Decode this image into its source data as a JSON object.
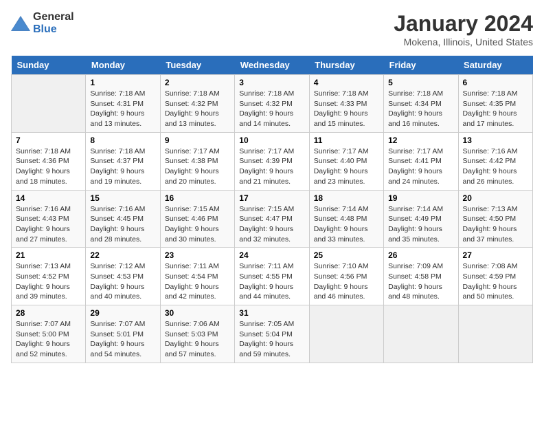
{
  "header": {
    "logo_general": "General",
    "logo_blue": "Blue",
    "title": "January 2024",
    "subtitle": "Mokena, Illinois, United States"
  },
  "days_of_week": [
    "Sunday",
    "Monday",
    "Tuesday",
    "Wednesday",
    "Thursday",
    "Friday",
    "Saturday"
  ],
  "weeks": [
    [
      {
        "day": "",
        "empty": true
      },
      {
        "day": "1",
        "sunrise": "Sunrise: 7:18 AM",
        "sunset": "Sunset: 4:31 PM",
        "daylight": "Daylight: 9 hours and 13 minutes."
      },
      {
        "day": "2",
        "sunrise": "Sunrise: 7:18 AM",
        "sunset": "Sunset: 4:32 PM",
        "daylight": "Daylight: 9 hours and 13 minutes."
      },
      {
        "day": "3",
        "sunrise": "Sunrise: 7:18 AM",
        "sunset": "Sunset: 4:32 PM",
        "daylight": "Daylight: 9 hours and 14 minutes."
      },
      {
        "day": "4",
        "sunrise": "Sunrise: 7:18 AM",
        "sunset": "Sunset: 4:33 PM",
        "daylight": "Daylight: 9 hours and 15 minutes."
      },
      {
        "day": "5",
        "sunrise": "Sunrise: 7:18 AM",
        "sunset": "Sunset: 4:34 PM",
        "daylight": "Daylight: 9 hours and 16 minutes."
      },
      {
        "day": "6",
        "sunrise": "Sunrise: 7:18 AM",
        "sunset": "Sunset: 4:35 PM",
        "daylight": "Daylight: 9 hours and 17 minutes."
      }
    ],
    [
      {
        "day": "7",
        "sunrise": "Sunrise: 7:18 AM",
        "sunset": "Sunset: 4:36 PM",
        "daylight": "Daylight: 9 hours and 18 minutes."
      },
      {
        "day": "8",
        "sunrise": "Sunrise: 7:18 AM",
        "sunset": "Sunset: 4:37 PM",
        "daylight": "Daylight: 9 hours and 19 minutes."
      },
      {
        "day": "9",
        "sunrise": "Sunrise: 7:17 AM",
        "sunset": "Sunset: 4:38 PM",
        "daylight": "Daylight: 9 hours and 20 minutes."
      },
      {
        "day": "10",
        "sunrise": "Sunrise: 7:17 AM",
        "sunset": "Sunset: 4:39 PM",
        "daylight": "Daylight: 9 hours and 21 minutes."
      },
      {
        "day": "11",
        "sunrise": "Sunrise: 7:17 AM",
        "sunset": "Sunset: 4:40 PM",
        "daylight": "Daylight: 9 hours and 23 minutes."
      },
      {
        "day": "12",
        "sunrise": "Sunrise: 7:17 AM",
        "sunset": "Sunset: 4:41 PM",
        "daylight": "Daylight: 9 hours and 24 minutes."
      },
      {
        "day": "13",
        "sunrise": "Sunrise: 7:16 AM",
        "sunset": "Sunset: 4:42 PM",
        "daylight": "Daylight: 9 hours and 26 minutes."
      }
    ],
    [
      {
        "day": "14",
        "sunrise": "Sunrise: 7:16 AM",
        "sunset": "Sunset: 4:43 PM",
        "daylight": "Daylight: 9 hours and 27 minutes."
      },
      {
        "day": "15",
        "sunrise": "Sunrise: 7:16 AM",
        "sunset": "Sunset: 4:45 PM",
        "daylight": "Daylight: 9 hours and 28 minutes."
      },
      {
        "day": "16",
        "sunrise": "Sunrise: 7:15 AM",
        "sunset": "Sunset: 4:46 PM",
        "daylight": "Daylight: 9 hours and 30 minutes."
      },
      {
        "day": "17",
        "sunrise": "Sunrise: 7:15 AM",
        "sunset": "Sunset: 4:47 PM",
        "daylight": "Daylight: 9 hours and 32 minutes."
      },
      {
        "day": "18",
        "sunrise": "Sunrise: 7:14 AM",
        "sunset": "Sunset: 4:48 PM",
        "daylight": "Daylight: 9 hours and 33 minutes."
      },
      {
        "day": "19",
        "sunrise": "Sunrise: 7:14 AM",
        "sunset": "Sunset: 4:49 PM",
        "daylight": "Daylight: 9 hours and 35 minutes."
      },
      {
        "day": "20",
        "sunrise": "Sunrise: 7:13 AM",
        "sunset": "Sunset: 4:50 PM",
        "daylight": "Daylight: 9 hours and 37 minutes."
      }
    ],
    [
      {
        "day": "21",
        "sunrise": "Sunrise: 7:13 AM",
        "sunset": "Sunset: 4:52 PM",
        "daylight": "Daylight: 9 hours and 39 minutes."
      },
      {
        "day": "22",
        "sunrise": "Sunrise: 7:12 AM",
        "sunset": "Sunset: 4:53 PM",
        "daylight": "Daylight: 9 hours and 40 minutes."
      },
      {
        "day": "23",
        "sunrise": "Sunrise: 7:11 AM",
        "sunset": "Sunset: 4:54 PM",
        "daylight": "Daylight: 9 hours and 42 minutes."
      },
      {
        "day": "24",
        "sunrise": "Sunrise: 7:11 AM",
        "sunset": "Sunset: 4:55 PM",
        "daylight": "Daylight: 9 hours and 44 minutes."
      },
      {
        "day": "25",
        "sunrise": "Sunrise: 7:10 AM",
        "sunset": "Sunset: 4:56 PM",
        "daylight": "Daylight: 9 hours and 46 minutes."
      },
      {
        "day": "26",
        "sunrise": "Sunrise: 7:09 AM",
        "sunset": "Sunset: 4:58 PM",
        "daylight": "Daylight: 9 hours and 48 minutes."
      },
      {
        "day": "27",
        "sunrise": "Sunrise: 7:08 AM",
        "sunset": "Sunset: 4:59 PM",
        "daylight": "Daylight: 9 hours and 50 minutes."
      }
    ],
    [
      {
        "day": "28",
        "sunrise": "Sunrise: 7:07 AM",
        "sunset": "Sunset: 5:00 PM",
        "daylight": "Daylight: 9 hours and 52 minutes."
      },
      {
        "day": "29",
        "sunrise": "Sunrise: 7:07 AM",
        "sunset": "Sunset: 5:01 PM",
        "daylight": "Daylight: 9 hours and 54 minutes."
      },
      {
        "day": "30",
        "sunrise": "Sunrise: 7:06 AM",
        "sunset": "Sunset: 5:03 PM",
        "daylight": "Daylight: 9 hours and 57 minutes."
      },
      {
        "day": "31",
        "sunrise": "Sunrise: 7:05 AM",
        "sunset": "Sunset: 5:04 PM",
        "daylight": "Daylight: 9 hours and 59 minutes."
      },
      {
        "day": "",
        "empty": true
      },
      {
        "day": "",
        "empty": true
      },
      {
        "day": "",
        "empty": true
      }
    ]
  ]
}
